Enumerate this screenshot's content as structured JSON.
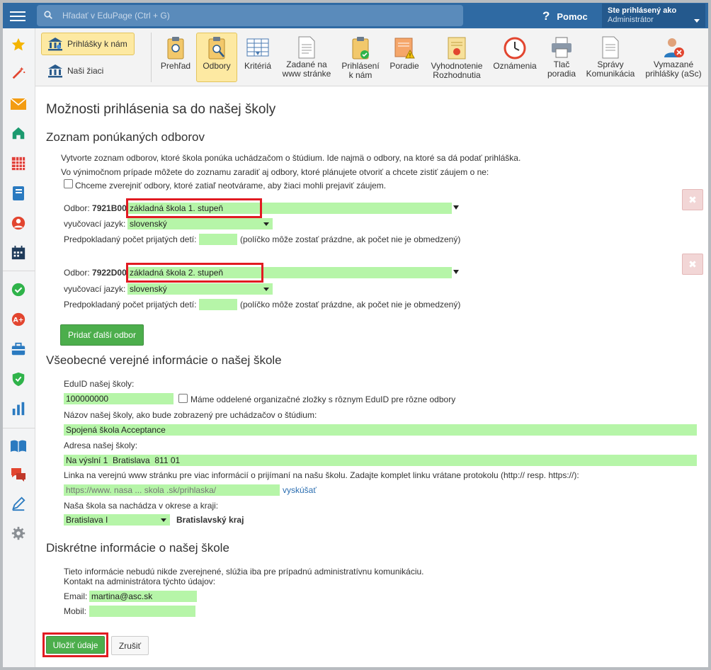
{
  "colors": {
    "topbar": "#2f6aa3",
    "field": "#b6f5a8",
    "active_tab": "#fde9a2",
    "highlight": "#e11b22",
    "primary_button": "#4cae4c"
  },
  "search": {
    "placeholder": "Hľadať v EduPage (Ctrl + G)"
  },
  "help": {
    "icon": "?",
    "label": "Pomoc"
  },
  "user": {
    "status": "Ste prihlásený ako",
    "name": "Administrátor"
  },
  "sidebar": {
    "icons": [
      "star-icon",
      "magic-wand-icon",
      "envelope-icon",
      "home-icon",
      "timetable-icon",
      "notebook-icon",
      "person-icon",
      "calendar-icon",
      "check-icon",
      "grade-icon",
      "briefcase-icon",
      "shield-icon",
      "bar-chart-icon",
      "book-icon",
      "chat-icon",
      "pen-icon",
      "gear-icon"
    ]
  },
  "toolbar": {
    "left_tabs": [
      {
        "label": "Prihlášky k nám",
        "icon": "bank-icon",
        "active": true
      },
      {
        "label": "Naši žiaci",
        "icon": "bank-icon",
        "active": false
      }
    ],
    "tools": [
      {
        "line1": "Prehľad",
        "line2": ""
      },
      {
        "line1": "Odbory",
        "line2": ""
      },
      {
        "line1": "Kritériá",
        "line2": ""
      },
      {
        "line1": "Zadané na",
        "line2": "www stránke"
      },
      {
        "line1": "Prihlásení",
        "line2": "k nám"
      },
      {
        "line1": "Poradie",
        "line2": ""
      },
      {
        "line1": "Vyhodnotenie",
        "line2": "Rozhodnutia"
      },
      {
        "line1": "Oznámenia",
        "line2": ""
      },
      {
        "line1": "Tlač",
        "line2": "poradia"
      },
      {
        "line1": "Správy",
        "line2": "Komunikácia"
      },
      {
        "line1": "Vymazané",
        "line2": "prihlášky (aSc)"
      }
    ]
  },
  "page": {
    "title": "Možnosti prihlásenia sa do našej školy"
  },
  "fields_section": {
    "title": "Zoznam ponúkaných odborov",
    "intro1": "Vytvorte zoznam odborov, ktoré škola ponúka uchádzačom o štúdium. Ide najmä o odbory, na ktoré sa dá podať prihláška.",
    "intro2": "Vo výnimočnom prípade môžete do zoznamu zaradiť aj odbory, ktoré plánujete otvoriť a chcete zistiť záujem o ne:",
    "checkbox_label": "Chceme zverejniť odbory, ktoré zatiaľ neotvárame, aby žiaci mohli prejaviť záujem.",
    "odbor_label": "Odbor:",
    "language_label": "vyučovací jazyk:",
    "count_label": "Predpokladaný počet prijatých detí:",
    "count_hint": "(políčko môže zostať prázdne, ak počet nie je obmedzený)",
    "odbory": [
      {
        "code": "7921B00",
        "name": "základná škola 1. stupeň",
        "language": "slovenský",
        "count": ""
      },
      {
        "code": "7922D00",
        "name": "základná škola 2. stupeň",
        "language": "slovenský",
        "count": ""
      }
    ],
    "delete_icon": "✖",
    "add_button": "Pridať ďalší odbor"
  },
  "public_section": {
    "title": "Všeobecné verejné informácie o našej škole",
    "eduid_label": "EduID našej školy:",
    "eduid_value": "100000000",
    "eduid_checkbox_label": "Máme oddelené organizačné zložky s rôznym EduID pre rôzne odbory",
    "name_label": "Názov našej školy, ako bude zobrazený pre uchádzačov o štúdium:",
    "name_value": "Spojená škola Acceptance",
    "address_label": "Adresa našej školy:",
    "address_value": "Na výslní 1  Bratislava  811 01",
    "link_label": "Linka na verejnú www stránku pre viac informácií o prijímaní na našu školu. Zadajte komplet linku vrátane protokolu (http:// resp. https://):",
    "link_placeholder": "https://www. nasa ... skola .sk/prihlaska/",
    "try_link": "vyskúšať",
    "region_label": "Naša škola sa nachádza v okrese a kraji:",
    "district_value": "Bratislava I",
    "region_value": "Bratislavský kraj"
  },
  "private_section": {
    "title": "Diskrétne informácie o našej škole",
    "info1": "Tieto informácie nebudú nikde zverejnené, slúžia iba pre prípadnú administratívnu komunikáciu.",
    "info2": "Kontakt na administrátora týchto údajov:",
    "email_label": "Email:",
    "email_value": "martina@asc.sk",
    "mobile_label": "Mobil:",
    "mobile_value": ""
  },
  "actions": {
    "save": "Uložiť údaje",
    "cancel": "Zrušiť"
  }
}
